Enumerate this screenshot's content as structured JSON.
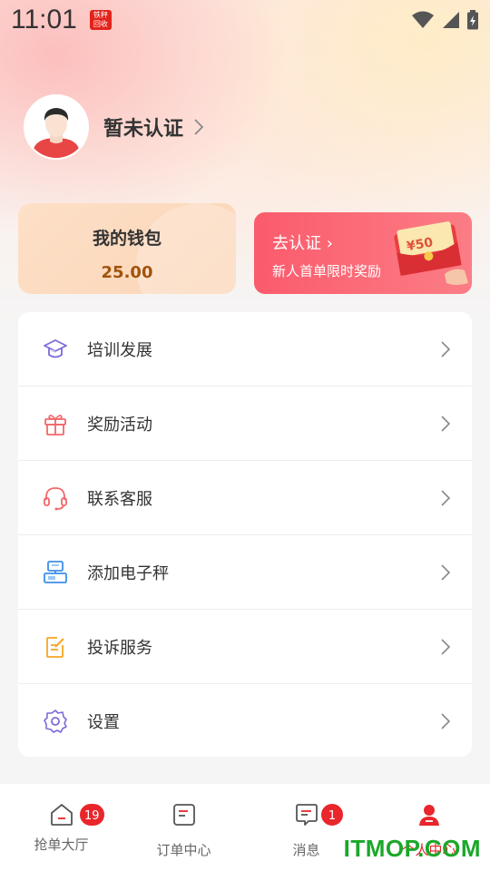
{
  "status_bar": {
    "time": "11:01",
    "app_badge_top": "铁秤",
    "app_badge_bottom": "回收",
    "icons": [
      "wifi-icon",
      "signal-icon",
      "battery-icon"
    ]
  },
  "profile": {
    "name": "暂未认证",
    "avatar": "avatar-icon"
  },
  "wallet": {
    "title": "我的钱包",
    "value": "25.00"
  },
  "promo": {
    "title": "去认证 ›",
    "subtitle": "新人首单限时奖励",
    "amount": "¥50"
  },
  "menu": {
    "items": [
      {
        "label": "培训发展",
        "icon": "graduation-cap-icon",
        "color": "#7b6cd9"
      },
      {
        "label": "奖励活动",
        "icon": "gift-icon",
        "color": "#f2676b"
      },
      {
        "label": "联系客服",
        "icon": "headset-icon",
        "color": "#f2676b"
      },
      {
        "label": "添加电子秤",
        "icon": "scale-icon",
        "color": "#3c8fe8"
      },
      {
        "label": "投诉服务",
        "icon": "edit-note-icon",
        "color": "#f5a623"
      },
      {
        "label": "设置",
        "icon": "gear-icon",
        "color": "#7b6cd9"
      }
    ]
  },
  "tabbar": {
    "items": [
      {
        "label": "抢单大厅",
        "icon": "home-icon",
        "badge": "19"
      },
      {
        "label": "订单中心",
        "icon": "order-icon",
        "badge": ""
      },
      {
        "label": "消息",
        "icon": "message-icon",
        "badge": "1"
      },
      {
        "label": "个人中心",
        "icon": "person-icon",
        "badge": ""
      }
    ]
  },
  "watermark": "ITMOP.COM",
  "colors": {
    "accent": "#e8262b",
    "wallet_value": "#a0540d",
    "promo_bg": "#fb5b6c"
  }
}
